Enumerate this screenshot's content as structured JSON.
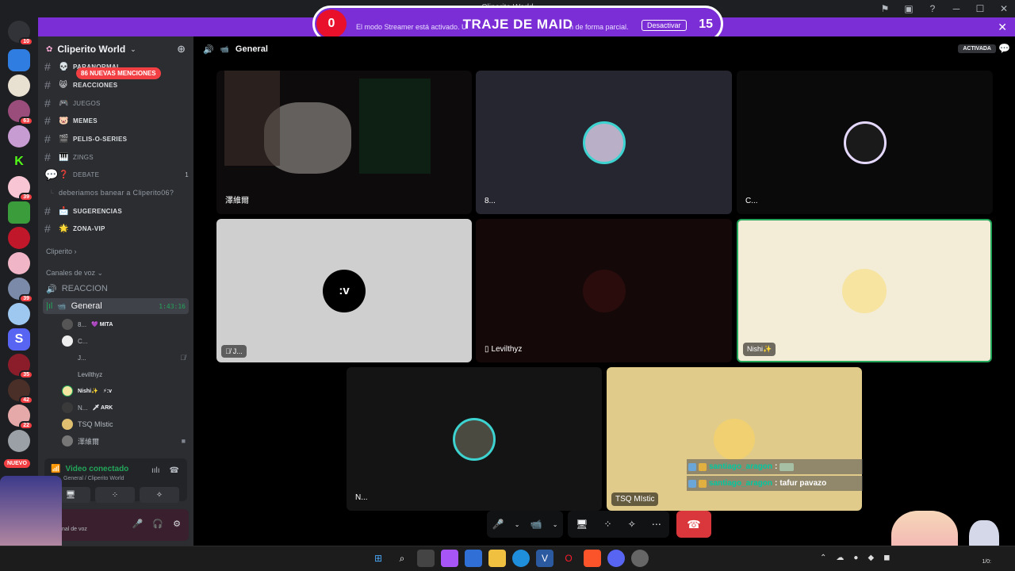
{
  "window": {
    "title": "Cliperito World"
  },
  "streamer_banner": {
    "message_left": "El modo Streamer está activado. U",
    "message_right": "n de forma parcial.",
    "deactivate_label": "Desactivar",
    "overlay_heading": "TRAJE DE MAID",
    "score_left": "0",
    "score_right": "15"
  },
  "servers": {
    "nuevo_label": "NUEVO",
    "badges": [
      "10",
      "63",
      "39",
      "39",
      "35",
      "42",
      "22"
    ]
  },
  "sidebar": {
    "guild_name": "Cliperito World",
    "mentions_pill": "86 NUEVAS MENCIONES",
    "channels": [
      {
        "emoji": "💀",
        "label": "PARANORMAL"
      },
      {
        "emoji": "😸",
        "label": "REACCIONES"
      },
      {
        "emoji": "🎮",
        "label": "JUEGOS"
      },
      {
        "emoji": "🐷",
        "label": "MEMES"
      },
      {
        "emoji": "🎬",
        "label": "PELIS-O-SERIES"
      },
      {
        "emoji": "🎹",
        "label": "ZINGS"
      },
      {
        "emoji": "❓",
        "label": "DEBATE",
        "count": "1"
      },
      {
        "emoji": "",
        "label": "deberiamos banear a Cliperito06?"
      },
      {
        "emoji": "📩",
        "label": "SUGERENCIAS"
      },
      {
        "emoji": "🌟",
        "label": "ZONA-VIP"
      }
    ],
    "category_cliperito": "Cliperito",
    "category_voice": "Canales de voz",
    "voice_channels": [
      {
        "label": "REACCION"
      },
      {
        "label": "General",
        "time": "1:43:16"
      }
    ],
    "members": [
      {
        "name": "8...",
        "tag": "💜 MITA"
      },
      {
        "name": "C..."
      },
      {
        "name": "J..."
      },
      {
        "name": "Levilthyz"
      },
      {
        "name": "Nishi✨",
        "tag": "⚡:v"
      },
      {
        "name": "N...",
        "tag": "🗡 ARK"
      },
      {
        "name": "TSQ MIstic"
      },
      {
        "name": "澤維爾"
      }
    ]
  },
  "voice_panel": {
    "status": "Video conectado",
    "location": "General / Cliperito World"
  },
  "user_panel": {
    "subtitle": "nal de voz"
  },
  "main": {
    "channel_name": "General",
    "activada_label": "ACTIVADA",
    "tiles": [
      {
        "name": "澤維爾"
      },
      {
        "name": "8..."
      },
      {
        "name": "C..."
      },
      {
        "name": "J...",
        "avatar_text": ":v"
      },
      {
        "name": "Levilthyz"
      },
      {
        "name": "Nishi✨"
      },
      {
        "name": "N..."
      },
      {
        "name": "TSQ MIstic"
      }
    ],
    "chat_overlay": [
      {
        "user": "santiago_aragon",
        "message": ""
      },
      {
        "user": "santiago_aragon",
        "message": "tafur pavazo"
      }
    ]
  },
  "taskbar": {
    "clock": "1/0:"
  }
}
